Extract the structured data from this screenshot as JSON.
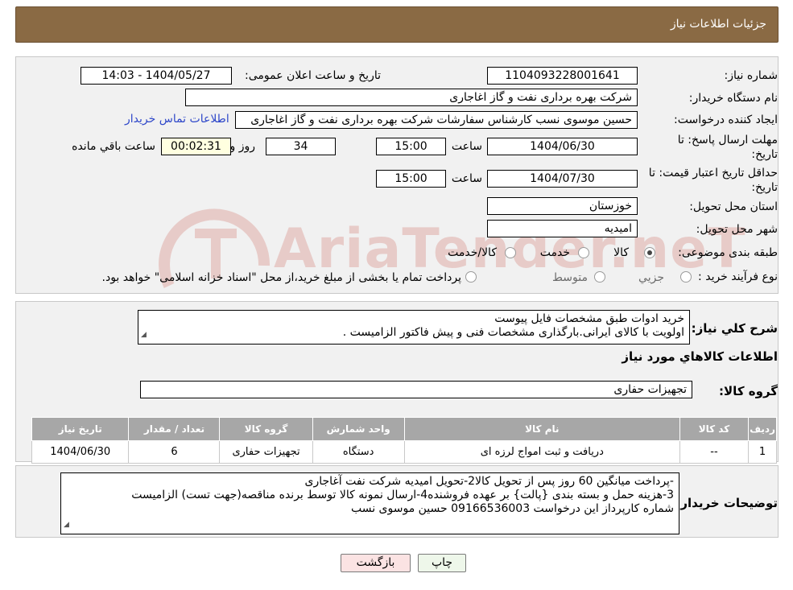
{
  "header": {
    "title": "جزئیات اطلاعات نیاز"
  },
  "form": {
    "need_number_label": "شماره نیاز:",
    "need_number": "1104093228001641",
    "announce_label": "تاریخ و ساعت اعلان عمومی:",
    "announce_value": "1404/05/27 - 14:03",
    "buyer_org_label": "نام دستگاه خریدار:",
    "buyer_org": "شرکت بهره برداری نفت و گاز اغاجاری",
    "creator_label": "ایجاد کننده درخواست:",
    "creator": "حسین موسوی نسب کارشناس سفارشات شرکت بهره برداری نفت و گاز اغاجاری",
    "contact_link": "اطلاعات تماس خریدار",
    "deadline_label_1": "مهلت ارسال پاسخ: تا",
    "deadline_label_2": "تاریخ:",
    "deadline_date": "1404/06/30",
    "time_label": "ساعت",
    "deadline_time": "15:00",
    "days_value": "34",
    "days_label": "روز و",
    "remaining_time": "00:02:31",
    "remaining_label": "ساعت باقي مانده",
    "validity_label_1": "حداقل تاریخ اعتبار قیمت: تا",
    "validity_label_2": "تاریخ:",
    "validity_date": "1404/07/30",
    "validity_time": "15:00",
    "province_label": "استان محل تحویل:",
    "province": "خوزستان",
    "city_label": "شهر محل تحویل:",
    "city": "امیدیه",
    "category_label": "طبقه بندی موضوعی:",
    "category_options": [
      "کالا",
      "خدمت",
      "کالا/خدمت"
    ],
    "category_selected": 0,
    "process_label": "نوع فرآیند خرید :",
    "process_options": [
      "جزيي",
      "متوسط"
    ],
    "process_note": "پرداخت تمام یا بخشی از مبلغ خرید،از محل \"اسناد خزانه اسلامی\" خواهد بود."
  },
  "description": {
    "label": "شرح کلي نياز:",
    "lines": [
      "خرید ادوات طبق مشخصات فایل پیوست",
      "اولویت با کالای ایرانی.بارگذاری مشخصات فنی و پیش فاکتور الزامیست ."
    ]
  },
  "goods": {
    "section_title": "اطلاعات کالاهاي مورد نياز",
    "group_label": "گروه کالا:",
    "group_value": "تجهیزات حفاری",
    "columns": [
      "رديف",
      "کد کالا",
      "نام کالا",
      "واحد شمارش",
      "گروه کالا",
      "تعداد / مقدار",
      "تاريخ نياز"
    ],
    "rows": [
      [
        "1",
        "--",
        "دریافت و ثبت امواج لرزه ای",
        "دستگاه",
        "تجهیزات حفاری",
        "6",
        "1404/06/30"
      ]
    ]
  },
  "buyer_notes": {
    "label": "توضيحات خريدار:",
    "lines": [
      "-پرداخت میانگین 60 روز پس از تحویل کالا2-تحویل امیدیه شرکت نفت آغاجاری",
      "3-هزینه حمل  و بسته بندی {پالت} بر عهده فروشنده4-ارسال نمونه کالا توسط برنده مناقصه(جهت تست) الزامیست",
      "شماره کارپرداز این درخواست 09166536003 حسین موسوی نسب"
    ]
  },
  "buttons": {
    "print": "چاپ",
    "back": "بازگشت"
  },
  "colors": {
    "header_bg": "#8a6a44",
    "link": "#2e47c9",
    "back_button_bg": "#fbe3e3",
    "print_button_bg": "#eef7ea",
    "watermark": "#c0392b"
  },
  "watermark": "AriaTender.neT"
}
